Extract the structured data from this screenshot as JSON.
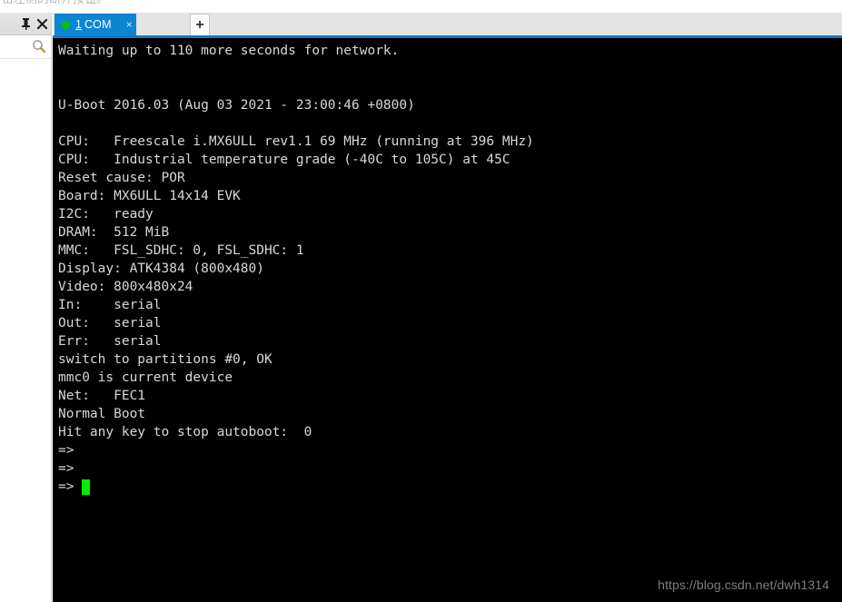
{
  "top_hint": {
    "text": "击左侧的断开按钮。"
  },
  "left_dock": {
    "pin_icon": "pin-icon",
    "close_icon": "close-icon",
    "search_icon": "search-icon"
  },
  "tabbar": {
    "active_tab": {
      "status_dot": "connected",
      "index": "1",
      "title": "COM",
      "close_label": "×"
    },
    "add_tab_label": "+"
  },
  "terminal": {
    "lines": [
      "Waiting up to 110 more seconds for network.",
      "",
      "",
      "U-Boot 2016.03 (Aug 03 2021 - 23:00:46 +0800)",
      "",
      "CPU:   Freescale i.MX6ULL rev1.1 69 MHz (running at 396 MHz)",
      "CPU:   Industrial temperature grade (-40C to 105C) at 45C",
      "Reset cause: POR",
      "Board: MX6ULL 14x14 EVK",
      "I2C:   ready",
      "DRAM:  512 MiB",
      "MMC:   FSL_SDHC: 0, FSL_SDHC: 1",
      "Display: ATK4384 (800x480)",
      "Video: 800x480x24",
      "In:    serial",
      "Out:   serial",
      "Err:   serial",
      "switch to partitions #0, OK",
      "mmc0 is current device",
      "Net:   FEC1",
      "Normal Boot",
      "Hit any key to stop autoboot:  0",
      "=>",
      "=>"
    ],
    "prompt": "=>",
    "cursor_color": "#00ec00",
    "text_color": "#d8d8d8",
    "background_color": "#000000"
  },
  "watermark": {
    "text": "https://blog.csdn.net/dwh1314"
  }
}
